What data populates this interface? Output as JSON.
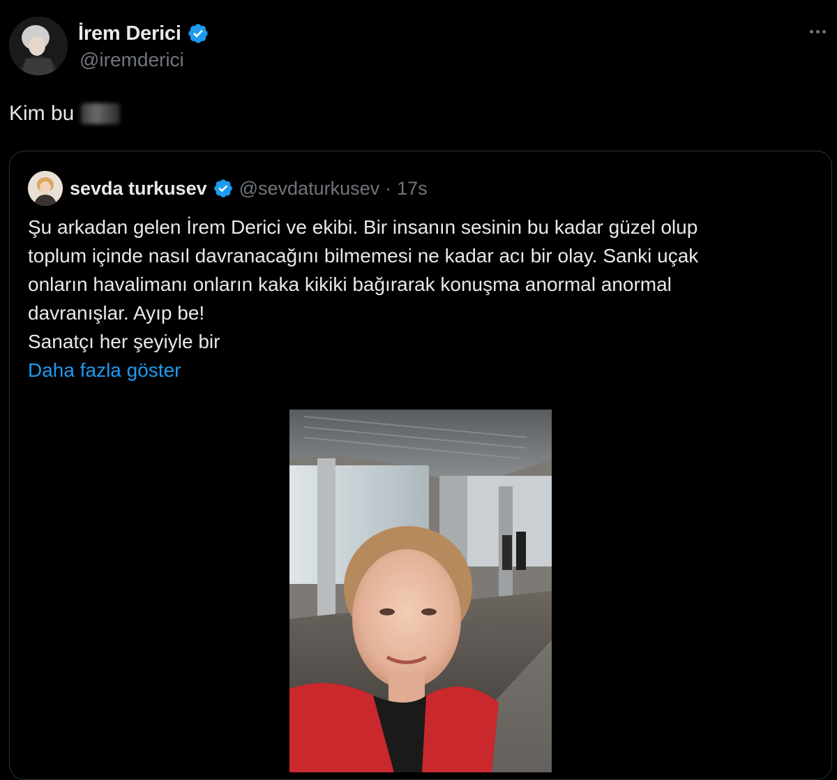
{
  "tweet": {
    "author": {
      "display_name": "İrem Derici",
      "handle": "@iremderici",
      "verified": true
    },
    "text": "Kim bu",
    "more_icon": "more-horizontal-icon"
  },
  "quoted_tweet": {
    "author": {
      "display_name": "sevda turkusev",
      "handle": "@sevdaturkusev",
      "verified": true
    },
    "separator": "·",
    "time": "17s",
    "lines": [
      "Şu arkadan gelen İrem Derici ve ekibi. Bir insanın sesinin bu kadar güzel olup",
      "toplum içinde nasıl davranacağını bilmemesi ne kadar acı bir olay. Sanki uçak",
      "onların havalimanı onların kaka kikiki bağırarak konuşma anormal anormal",
      "davranışlar. Ayıp be!",
      "Sanatçı her şeyiyle bir"
    ],
    "show_more": "Daha fazla göster"
  },
  "colors": {
    "background": "#000000",
    "text_primary": "#e7e9ea",
    "text_secondary": "#71767b",
    "link": "#1d9bf0",
    "border": "#2f3336",
    "verified_badge": "#1d9bf0"
  }
}
